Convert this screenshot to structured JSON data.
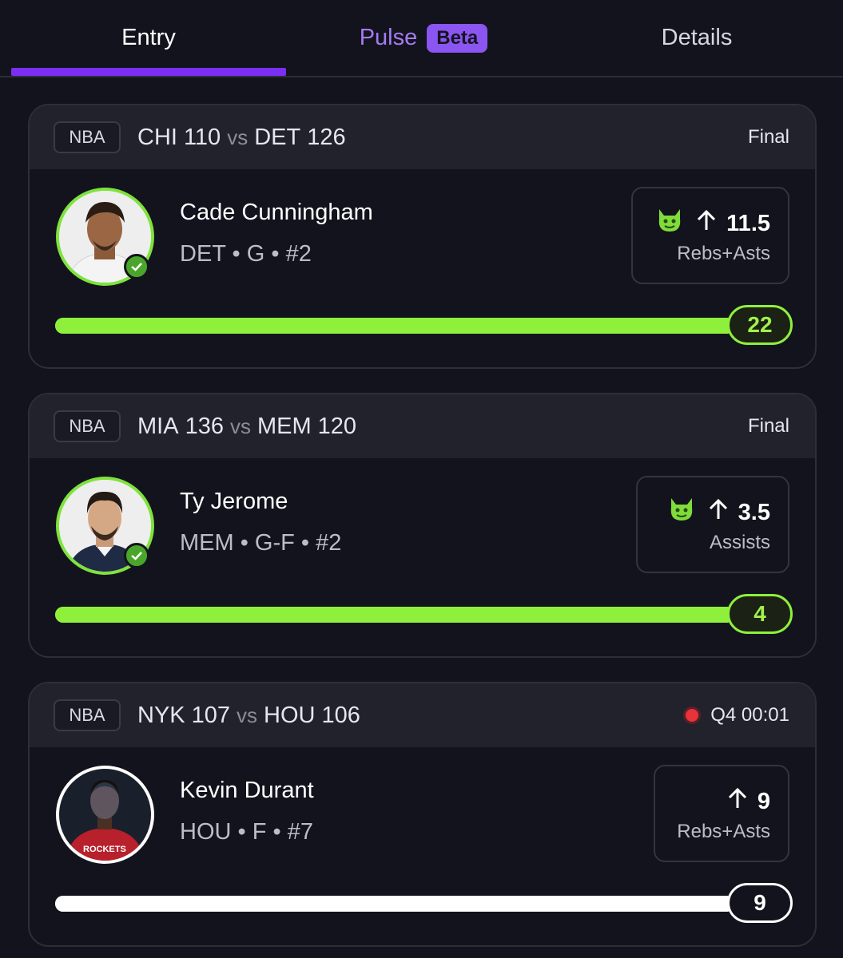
{
  "tabs": {
    "entry": "Entry",
    "pulse": "Pulse",
    "pulse_badge": "Beta",
    "details": "Details"
  },
  "colors": {
    "accent_purple": "#7b2ff2",
    "hit_green": "#8ef03b",
    "live_red": "#e8333a"
  },
  "cards": [
    {
      "league": "NBA",
      "away_team": "CHI",
      "away_score": "110",
      "vs": "vs",
      "home_team": "DET",
      "home_score": "126",
      "status": "Final",
      "player_name": "Cade Cunningham",
      "player_meta": "DET • G • #2",
      "line": "11.5",
      "stat": "Rebs+Asts",
      "current": "22",
      "progress": 1.0,
      "icons": [
        "demon-icon",
        "arrow-up-icon",
        "check-icon"
      ]
    },
    {
      "league": "NBA",
      "away_team": "MIA",
      "away_score": "136",
      "vs": "vs",
      "home_team": "MEM",
      "home_score": "120",
      "status": "Final",
      "player_name": "Ty Jerome",
      "player_meta": "MEM • G-F • #2",
      "line": "3.5",
      "stat": "Assists",
      "current": "4",
      "progress": 1.0,
      "icons": [
        "demon-icon",
        "arrow-up-icon",
        "check-icon"
      ]
    },
    {
      "league": "NBA",
      "away_team": "NYK",
      "away_score": "107",
      "vs": "vs",
      "home_team": "HOU",
      "home_score": "106",
      "status": "Q4 00:01",
      "player_name": "Kevin Durant",
      "player_meta": "HOU • F • #7",
      "line": "9",
      "stat": "Rebs+Asts",
      "current": "9",
      "progress": 1.0,
      "icons": [
        "live-dot-icon",
        "arrow-up-icon"
      ]
    }
  ]
}
